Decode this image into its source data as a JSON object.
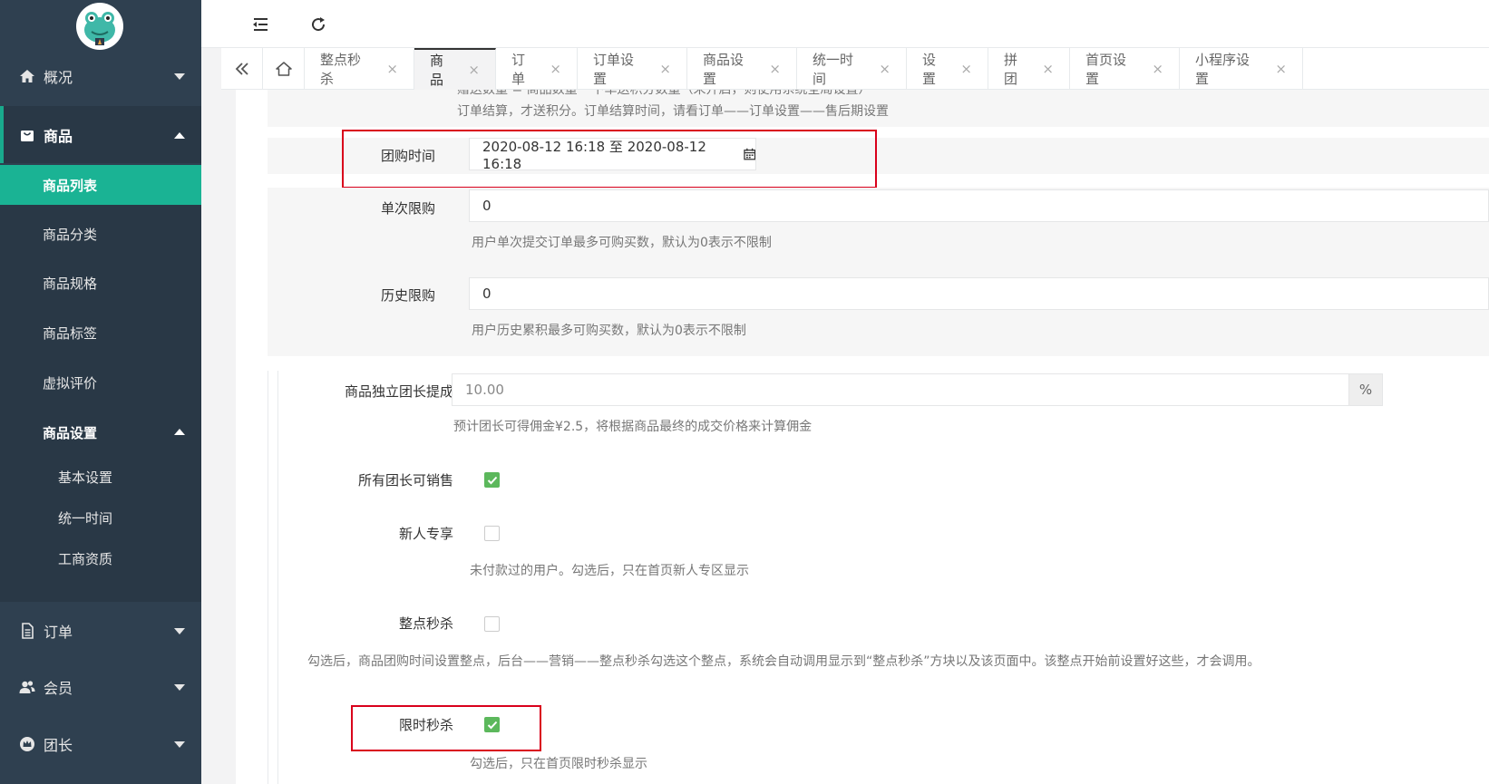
{
  "sidebar": {
    "nav": [
      {
        "label": "概况",
        "icon": "home-icon"
      },
      {
        "label": "商品",
        "icon": "shopping-bag-icon"
      },
      {
        "label": "订单",
        "icon": "document-icon"
      },
      {
        "label": "会员",
        "icon": "users-icon"
      },
      {
        "label": "团长",
        "icon": "crown-icon"
      }
    ],
    "submenu": [
      "商品列表",
      "商品分类",
      "商品规格",
      "商品标签",
      "虚拟评价",
      "商品设置"
    ],
    "submenu2": [
      "基本设置",
      "统一时间",
      "工商资质"
    ]
  },
  "tabs": [
    {
      "label": "整点秒杀",
      "close": "×"
    },
    {
      "label": "商品",
      "close": "×"
    },
    {
      "label": "订单",
      "close": "×"
    },
    {
      "label": "订单设置",
      "close": "×"
    },
    {
      "label": "商品设置",
      "close": "×"
    },
    {
      "label": "统一时间",
      "close": "×"
    },
    {
      "label": "设置",
      "close": "×"
    },
    {
      "label": "拼团",
      "close": "×"
    },
    {
      "label": "首页设置",
      "close": "×"
    },
    {
      "label": "小程序设置",
      "close": "×"
    }
  ],
  "form": {
    "top_help1": "赠送数量 = 商品数量 * 下单送积分数量（未开启，则使用系统全局设置）",
    "top_help2": "订单结算，才送积分。订单结算时间，请看订单——订单设置——售后期设置",
    "group_time_label": "团购时间",
    "group_time_value": "2020-08-12 16:18 至 2020-08-12 16:18",
    "single_limit_label": "单次限购",
    "single_limit_value": "0",
    "single_limit_help": "用户单次提交订单最多可购买数，默认为0表示不限制",
    "history_limit_label": "历史限购",
    "history_limit_value": "0",
    "history_limit_help": "用户历史累积最多可购买数，默认为0表示不限制",
    "commission_label": "商品独立团长提成",
    "commission_value": "10.00",
    "commission_unit": "%",
    "commission_help": "预计团长可得佣金¥2.5，将根据商品最终的成交价格来计算佣金",
    "all_leaders_label": "所有团长可销售",
    "all_leaders_checked": true,
    "newbie_label": "新人专享",
    "newbie_checked": false,
    "newbie_help": "未付款过的用户。勾选后，只在首页新人专区显示",
    "hourly_label": "整点秒杀",
    "hourly_checked": false,
    "hourly_help": "勾选后，商品团购时间设置整点，后台——营销——整点秒杀勾选这个整点，系统会自动调用显示到“整点秒杀”方块以及该页面中。该整点开始前设置好这些，才会调用。",
    "flash_label": "限时秒杀",
    "flash_checked": true,
    "flash_help": "勾选后，只在首页限时秒杀显示"
  }
}
